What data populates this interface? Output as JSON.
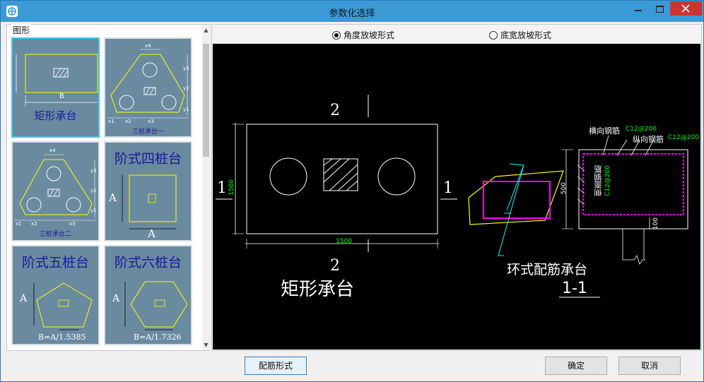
{
  "window": {
    "title": "参数化选择"
  },
  "left": {
    "group_label": "图形",
    "thumbs": [
      {
        "caption": "矩形承台",
        "dim_b": "B"
      },
      {
        "caption": "三桩承台一",
        "labels": {
          "x4": "x4",
          "x1": "x1",
          "x2": "x2",
          "x3": "x3",
          "y1": "y1",
          "y2": "y2",
          "y3": "y3"
        }
      },
      {
        "caption": "三桩承台二",
        "labels": {
          "x4": "x4",
          "x1": "x1",
          "x2": "x2",
          "x3": "x3",
          "y1": "y1",
          "y2": "y2",
          "y3": "y3"
        }
      },
      {
        "title": "阶式四桩台",
        "dim_a1": "A",
        "dim_a2": "A"
      },
      {
        "title": "阶式五桩台",
        "dim_a": "A",
        "formula": "B=A/1.5385"
      },
      {
        "title": "阶式六桩台",
        "dim_a": "A",
        "formula": "B=A/1.7326"
      }
    ]
  },
  "right": {
    "radio_angle": {
      "label": "角度放坡形式",
      "checked": true
    },
    "radio_bottom": {
      "label": "底宽放坡形式",
      "checked": false
    },
    "drawing": {
      "section_top": "2",
      "section_bottom": "2",
      "section_left": "1",
      "section_right": "1",
      "dim_height": "1500",
      "dim_width": "1500",
      "main_caption": "矩形承台",
      "ring_caption": "环式配筋承台",
      "section_caption": "1-1",
      "label_transverse": "横向钢筋",
      "label_transverse_spec": "C12@200",
      "label_longitudinal": "纵向钢筋",
      "label_longitudinal_spec": "C12@200",
      "label_side": "侧面钢筋",
      "label_side_spec": "C12@200",
      "dim_section_h": "500",
      "dim_section_b": "100"
    }
  },
  "footer": {
    "rebar_button": "配筋形式",
    "ok_button": "确定",
    "cancel_button": "取消"
  },
  "colors": {
    "titlebar": "#3b9ad6",
    "thumb_bg": "#6a8aa0",
    "canvas": "#000000",
    "cad_green": "#00ff00",
    "cad_magenta": "#ff00ff",
    "cad_yellow": "#ffff00",
    "cad_cyan": "#00ffff"
  }
}
